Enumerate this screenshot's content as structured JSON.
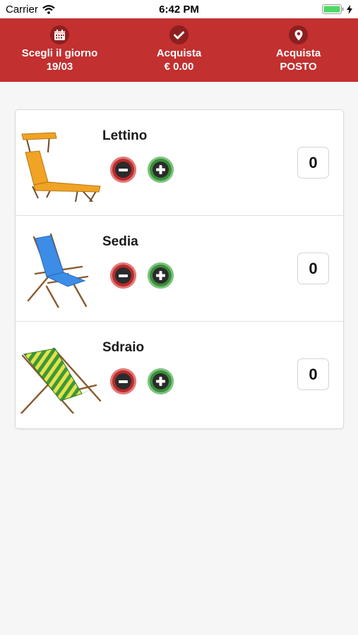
{
  "status_bar": {
    "carrier": "Carrier",
    "time": "6:42 PM"
  },
  "top_bar": {
    "color": "#c23030",
    "items": [
      {
        "icon": "calendar-icon",
        "line1": "Scegli il giorno",
        "line2": "19/03"
      },
      {
        "icon": "checkmark-icon",
        "line1": "Acquista",
        "line2": "€ 0.00"
      },
      {
        "icon": "location-pin-icon",
        "line1": "Acquista",
        "line2": "POSTO"
      }
    ]
  },
  "items": [
    {
      "name": "Lettino",
      "quantity": "0",
      "image": "sunbed-image"
    },
    {
      "name": "Sedia",
      "quantity": "0",
      "image": "beach-chair-image"
    },
    {
      "name": "Sdraio",
      "quantity": "0",
      "image": "deck-chair-image"
    }
  ]
}
